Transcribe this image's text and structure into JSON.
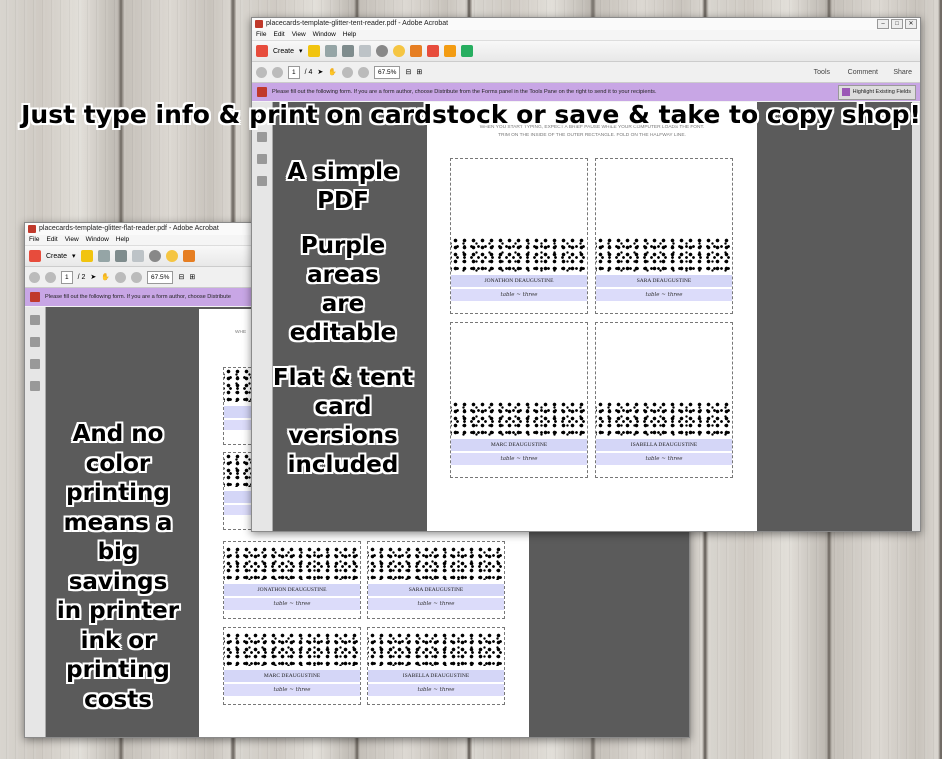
{
  "headline": "Just type info & print on cardstock or save & take to copy shop!",
  "note_right": [
    "A simple",
    "PDF",
    "",
    "Purple",
    "areas",
    "are",
    "editable",
    "",
    "Flat & tent",
    "card",
    "versions",
    "included"
  ],
  "note_left": [
    "And no",
    "color",
    "printing",
    "means a",
    "big",
    "savings",
    "in printer",
    "ink or",
    "printing",
    "costs"
  ],
  "tent_window": {
    "title": "placecards-template-glitter-tent-reader.pdf - Adobe Acrobat",
    "menu": [
      "File",
      "Edit",
      "View",
      "Window",
      "Help"
    ],
    "create": "Create",
    "page_num": "1",
    "page_total": "/ 4",
    "zoom": "67.5%",
    "tabs": [
      "Tools",
      "Comment",
      "Share"
    ],
    "form_message": "Please fill out the following form. If you are a form author, choose Distribute from the Forms panel in the Tools Pane on the right to send it to your recipients.",
    "highlight_button": "Highlight Existing Fields",
    "page_header_1": "WHEN YOU START TYPING, EXPECT A BRIEF PAUSE WHILE YOUR COMPUTER LOADS THE FONT.",
    "page_header_2": "TRIM ON THE INSIDE OF THE OUTER RECTANGLE. FOLD ON THE HALFWAY LINE.",
    "cards": [
      {
        "name": "JONATHON DEAUGUSTINE",
        "table": "table ~ three"
      },
      {
        "name": "SARA DEAUGUSTINE",
        "table": "table ~ three"
      },
      {
        "name": "MARC DEAUGUSTINE",
        "table": "table ~ three"
      },
      {
        "name": "ISABELLA DEAUGUSTINE",
        "table": "table ~ three"
      }
    ]
  },
  "flat_window": {
    "title": "placecards-template-glitter-flat-reader.pdf - Adobe Acrobat",
    "menu": [
      "File",
      "Edit",
      "View",
      "Window",
      "Help"
    ],
    "create": "Create",
    "page_num": "1",
    "page_total": "/ 2",
    "zoom": "67.5%",
    "form_message": "Please fill out the following form. If you are a form author, choose Distribute",
    "page_header": "WHE",
    "cards": [
      {
        "name": "JONATHON DEAUGUSTINE",
        "table": "table ~ three"
      },
      {
        "name": "SARA DEAUGUSTINE",
        "table": "table ~ three"
      },
      {
        "name": "MARC DEAUGUSTINE",
        "table": "table ~ three"
      },
      {
        "name": "ISABELLA DEAUGUSTINE",
        "table": "table ~ three"
      }
    ]
  },
  "colors": {
    "form_bar": "#c8a6e5",
    "editable_field": "#d4d6f7",
    "workspace": "#5b5b5b"
  }
}
